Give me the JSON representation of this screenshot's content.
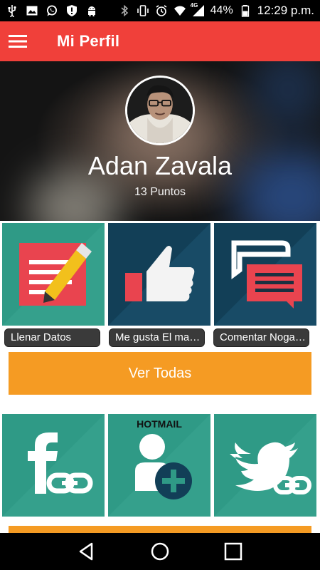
{
  "status_bar": {
    "battery": "44%",
    "network": "4G",
    "time": "12:29 p.m.",
    "icons": [
      "usb-icon",
      "gallery-icon",
      "whatsapp-icon",
      "alert-shield-icon",
      "android-icon",
      "bluetooth-icon",
      "vibrate-icon",
      "alarm-icon",
      "wifi-icon",
      "signal-icon",
      "battery-icon"
    ]
  },
  "app_bar": {
    "title": "Mi Perfil",
    "background": "#f0403a"
  },
  "profile": {
    "name": "Adan Zavala",
    "points": "13 Puntos"
  },
  "tiles_top": [
    {
      "label": "Llenar Datos",
      "icon": "edit-form-icon"
    },
    {
      "label": "Me gusta El ma…",
      "icon": "thumbs-up-icon"
    },
    {
      "label": "Comentar Noga…",
      "icon": "comment-icon"
    }
  ],
  "buttons": {
    "see_all": "Ver Todas"
  },
  "tiles_bottom": [
    {
      "icon": "facebook-link-icon"
    },
    {
      "caption": "HOTMAIL",
      "icon": "add-user-icon"
    },
    {
      "icon": "twitter-link-icon"
    }
  ],
  "colors": {
    "accent": "#f0403a",
    "orange": "#f59b23",
    "teal": "#2f9a86",
    "navy": "#123f57",
    "tile_red": "#e9444f"
  },
  "nav": {
    "icons": [
      "back-icon",
      "home-icon",
      "recents-icon"
    ]
  }
}
